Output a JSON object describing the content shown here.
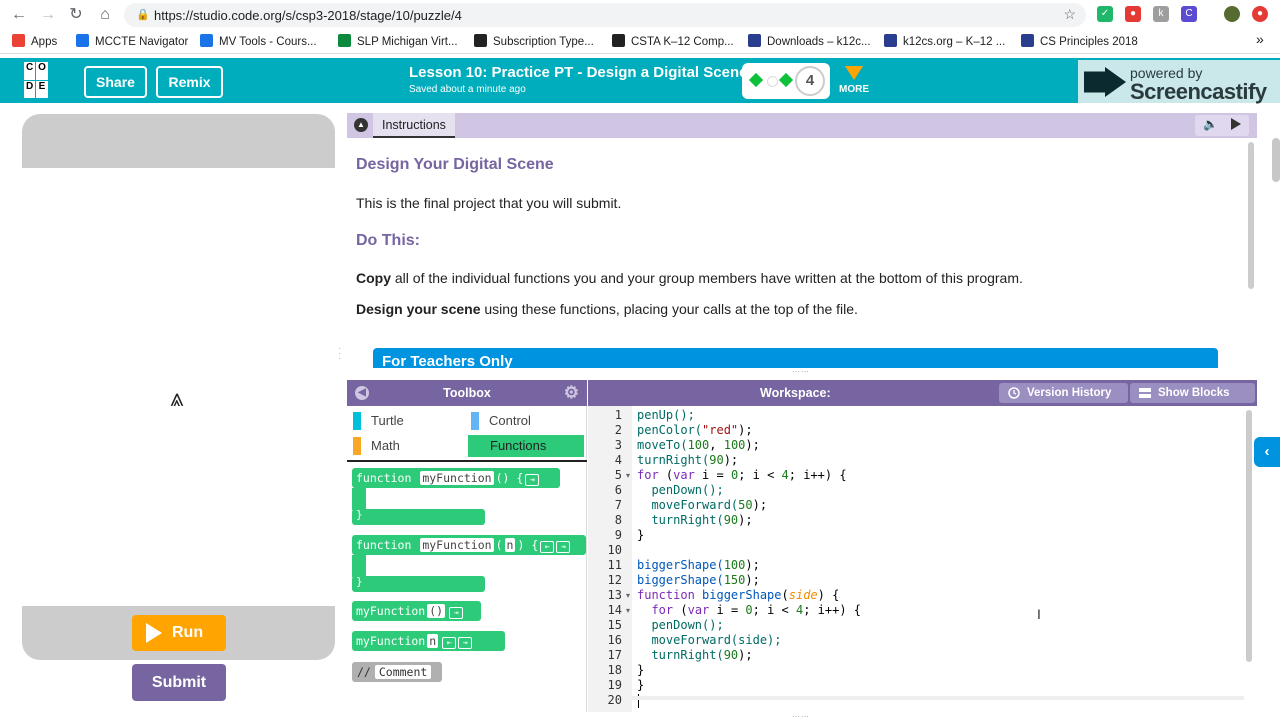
{
  "browser": {
    "url": "https://studio.code.org/s/csp3-2018/stage/10/puzzle/4",
    "bookmarks": [
      {
        "label": "Apps",
        "color": "#ea4335"
      },
      {
        "label": "MCCTE Navigator",
        "color": "#1a73e8"
      },
      {
        "label": "MV Tools - Cours...",
        "color": "#1a73e8"
      },
      {
        "label": "SLP Michigan Virt...",
        "color": "#0b8a3e"
      },
      {
        "label": "Subscription Type...",
        "color": "#222222"
      },
      {
        "label": "CSTA K–12 Comp...",
        "color": "#222222"
      },
      {
        "label": "Downloads – k12c...",
        "color": "#2b3d8f"
      },
      {
        "label": "k12cs.org – K–12 ...",
        "color": "#2b3d8f"
      },
      {
        "label": "CS Principles 2018",
        "color": "#2b3d8f"
      }
    ],
    "more_bookmarks": "»"
  },
  "header": {
    "logo_letters": [
      "C",
      "O",
      "",
      "D",
      "E",
      ""
    ],
    "share_label": "Share",
    "remix_label": "Remix",
    "lesson_title": "Lesson 10: Practice PT - Design a Digital Scene",
    "saved_status": "Saved about a minute ago",
    "current_level": "4",
    "more_label": "MORE",
    "castify_small": "powered by",
    "castify_big": "Screencastify"
  },
  "visualization": {
    "run_label": "Run",
    "submit_label": "Submit"
  },
  "instructions": {
    "tab_label": "Instructions",
    "heading": "Design Your Digital Scene",
    "intro": "This is the final project that you will submit.",
    "do_this": "Do This:",
    "copy_bold": "Copy",
    "copy_rest": " all of the individual functions you and your group members have written at the bottom of this program.",
    "design_bold": "Design your scene",
    "design_rest": " using these functions, placing your calls at the top of the file.",
    "teachers_only": "For Teachers Only"
  },
  "toolbox": {
    "title": "Toolbox",
    "categories": [
      {
        "label": "Turtle",
        "color": "#00bfdb"
      },
      {
        "label": "Control",
        "color": "#64b5f6"
      },
      {
        "label": "Math",
        "color": "#f9a825"
      },
      {
        "label": "Functions",
        "color": "#2dcb79"
      }
    ],
    "blocks": {
      "function_kw": "function",
      "func_name": "myFunction",
      "paren_empty": "()",
      "paren_n_open": "(",
      "param_n": "n",
      "paren_close": ")",
      "brace_open": "{",
      "brace_close": "}",
      "call_name": "myFunction",
      "comment_prefix": "//",
      "comment_text": "Comment"
    }
  },
  "workspace": {
    "title": "Workspace:",
    "version_history_label": "Version History",
    "show_blocks_label": "Show Blocks",
    "line_numbers": [
      "1",
      "2",
      "3",
      "4",
      "5",
      "6",
      "7",
      "8",
      "9",
      "10",
      "11",
      "12",
      "13",
      "14",
      "15",
      "16",
      "17",
      "18",
      "19",
      "20"
    ],
    "code": {
      "l1": "penUp();",
      "l2a": "penColor(",
      "l2b": "\"red\"",
      "l2c": ");",
      "l3a": "moveTo(",
      "l3b": "100",
      "l3c": ", ",
      "l3d": "100",
      "l3e": ");",
      "l4a": "turnRight(",
      "l4b": "90",
      "l4c": ");",
      "l5a": "for",
      "l5b": " (",
      "l5c": "var",
      "l5d": " i = ",
      "l5e": "0",
      "l5f": "; i < ",
      "l5g": "4",
      "l5h": "; i++) {",
      "l6": "  penDown();",
      "l7a": "  moveForward(",
      "l7b": "50",
      "l7c": ");",
      "l8a": "  turnRight(",
      "l8b": "90",
      "l8c": ");",
      "l9": "}",
      "l11a": "biggerShape(",
      "l11b": "100",
      "l11c": ");",
      "l12a": "biggerShape(",
      "l12b": "150",
      "l12c": ");",
      "l13a": "function",
      "l13b": " ",
      "l13c": "biggerShape",
      "l13d": "(",
      "l13e": "side",
      "l13f": ") {",
      "l14a": "  ",
      "l14b": "for",
      "l14c": " (",
      "l14d": "var",
      "l14e": " i = ",
      "l14f": "0",
      "l14g": "; i < ",
      "l14h": "4",
      "l14i": "; i++) {",
      "l15": "  penDown();",
      "l16": "  moveForward(side);",
      "l17a": "  turnRight(",
      "l17b": "90",
      "l17c": ");",
      "l18": "}",
      "l19": "}"
    },
    "fold_lines": [
      "5",
      "13",
      "14"
    ]
  },
  "colors": {
    "brand_teal": "#00adbc",
    "purple": "#7665a0",
    "run_orange": "#ffa400",
    "functions_green": "#2dcb79"
  }
}
